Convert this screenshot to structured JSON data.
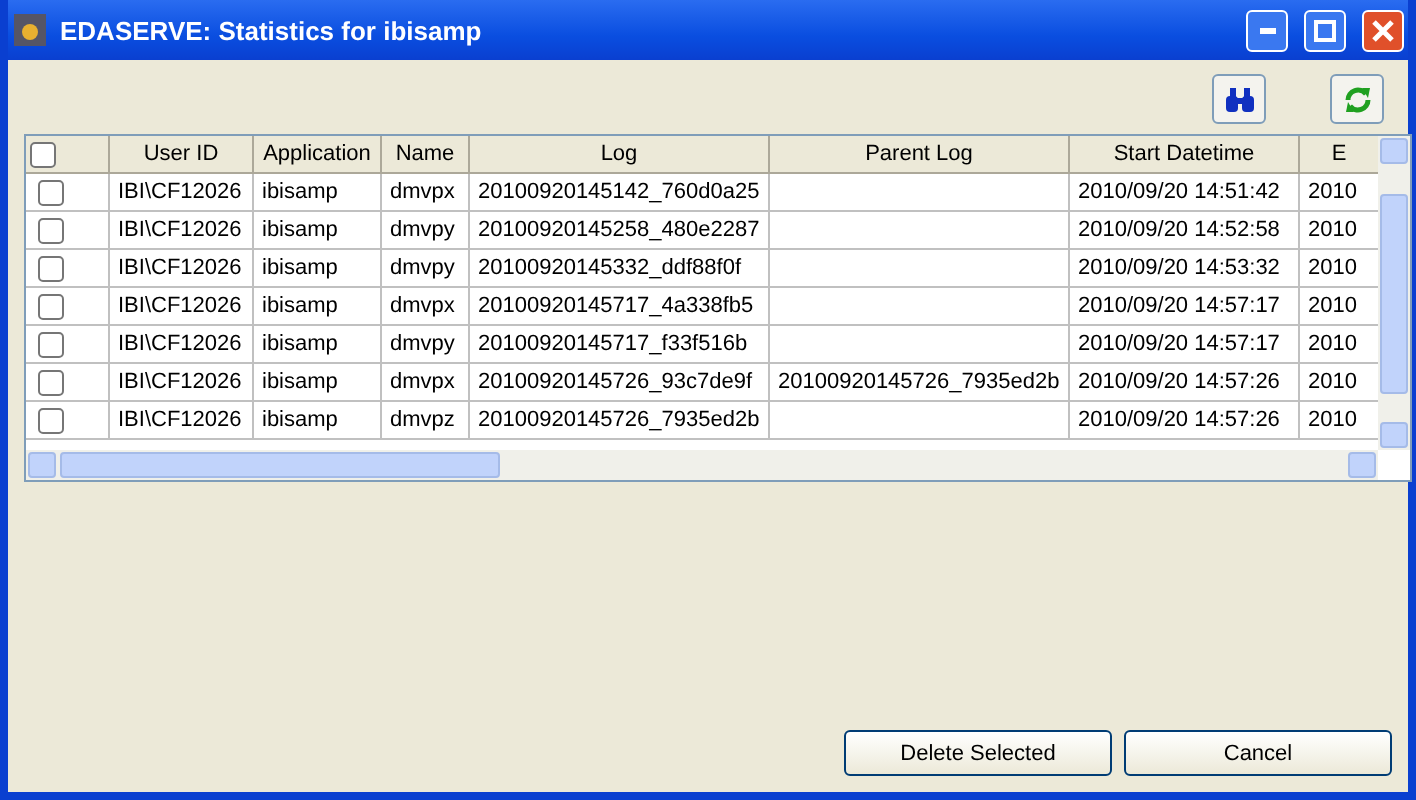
{
  "window": {
    "title": "EDASERVE: Statistics for ibisamp"
  },
  "table": {
    "header_checked": false,
    "columns": [
      "User ID",
      "Application",
      "Name",
      "Log",
      "Parent Log",
      "Start Datetime",
      "E"
    ],
    "rows": [
      {
        "checked": false,
        "cells": [
          "IBI\\CF12026",
          "ibisamp",
          "dmvpx",
          "20100920145142_760d0a25",
          "",
          "2010/09/20 14:51:42",
          "2010"
        ]
      },
      {
        "checked": false,
        "cells": [
          "IBI\\CF12026",
          "ibisamp",
          "dmvpy",
          "20100920145258_480e2287",
          "",
          "2010/09/20 14:52:58",
          "2010"
        ]
      },
      {
        "checked": false,
        "cells": [
          "IBI\\CF12026",
          "ibisamp",
          "dmvpy",
          "20100920145332_ddf88f0f",
          "",
          "2010/09/20 14:53:32",
          "2010"
        ]
      },
      {
        "checked": false,
        "cells": [
          "IBI\\CF12026",
          "ibisamp",
          "dmvpx",
          "20100920145717_4a338fb5",
          "",
          "2010/09/20 14:57:17",
          "2010"
        ]
      },
      {
        "checked": false,
        "cells": [
          "IBI\\CF12026",
          "ibisamp",
          "dmvpy",
          "20100920145717_f33f516b",
          "",
          "2010/09/20 14:57:17",
          "2010"
        ]
      },
      {
        "checked": false,
        "cells": [
          "IBI\\CF12026",
          "ibisamp",
          "dmvpx",
          "20100920145726_93c7de9f",
          "20100920145726_7935ed2b",
          "2010/09/20 14:57:26",
          "2010"
        ]
      },
      {
        "checked": false,
        "cells": [
          "IBI\\CF12026",
          "ibisamp",
          "dmvpz",
          "20100920145726_7935ed2b",
          "",
          "2010/09/20 14:57:26",
          "2010"
        ]
      }
    ]
  },
  "buttons": [
    "Delete Selected",
    "Cancel"
  ]
}
